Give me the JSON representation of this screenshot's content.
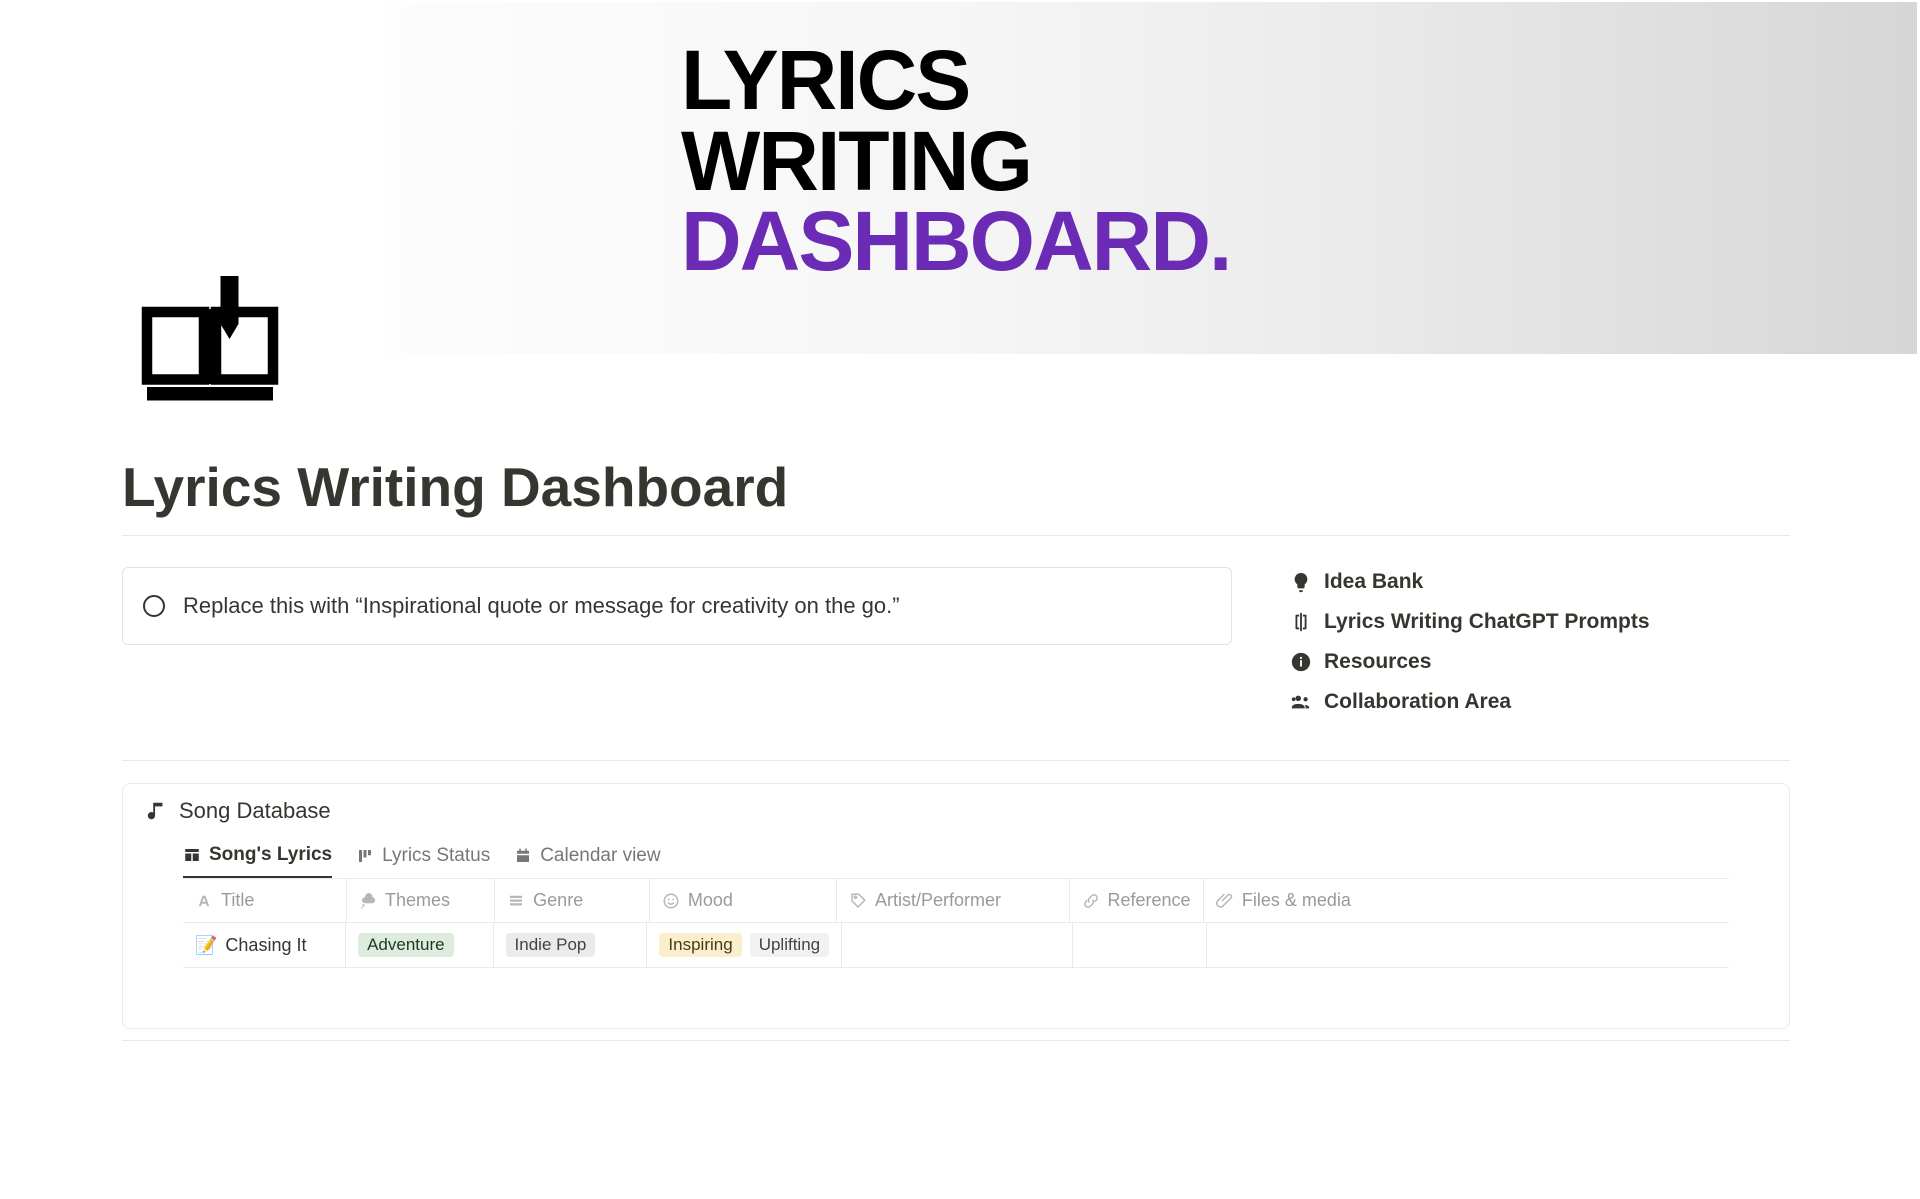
{
  "hero": {
    "line1": "LYRICS",
    "line2": "WRITING",
    "line3": "DASHBOARD."
  },
  "page_title": "Lyrics Writing Dashboard",
  "quote_placeholder": "Replace this with “Inspirational quote or message for creativity on the go.”",
  "sidebar": {
    "items": [
      {
        "label": "Idea Bank",
        "icon": "lightbulb-icon"
      },
      {
        "label": "Lyrics Writing ChatGPT Prompts",
        "icon": "text-cursor-icon"
      },
      {
        "label": "Resources",
        "icon": "info-icon"
      },
      {
        "label": "Collaboration Area",
        "icon": "people-icon"
      }
    ]
  },
  "database": {
    "title": "Song Database",
    "tabs": [
      {
        "label": "Song's Lyrics",
        "icon": "table-icon",
        "active": true
      },
      {
        "label": "Lyrics Status",
        "icon": "board-icon",
        "active": false
      },
      {
        "label": "Calendar view",
        "icon": "calendar-icon",
        "active": false
      }
    ],
    "columns": [
      {
        "key": "title",
        "label": "Title",
        "icon": "text-type-icon"
      },
      {
        "key": "themes",
        "label": "Themes",
        "icon": "thought-icon"
      },
      {
        "key": "genre",
        "label": "Genre",
        "icon": "stack-icon"
      },
      {
        "key": "mood",
        "label": "Mood",
        "icon": "smile-icon"
      },
      {
        "key": "artist",
        "label": "Artist/Performer",
        "icon": "tag-icon"
      },
      {
        "key": "reference",
        "label": "Reference",
        "icon": "link-icon"
      },
      {
        "key": "files",
        "label": "Files & media",
        "icon": "clip-icon"
      }
    ],
    "rows": [
      {
        "emoji": "📝",
        "title": "Chasing It",
        "themes": [
          {
            "text": "Adventure",
            "color": "green"
          }
        ],
        "genre": [
          {
            "text": "Indie Pop",
            "color": "gray"
          }
        ],
        "mood": [
          {
            "text": "Inspiring",
            "color": "yellow"
          },
          {
            "text": "Uplifting",
            "color": "light"
          }
        ],
        "artist": "",
        "reference": "",
        "files": ""
      }
    ]
  }
}
